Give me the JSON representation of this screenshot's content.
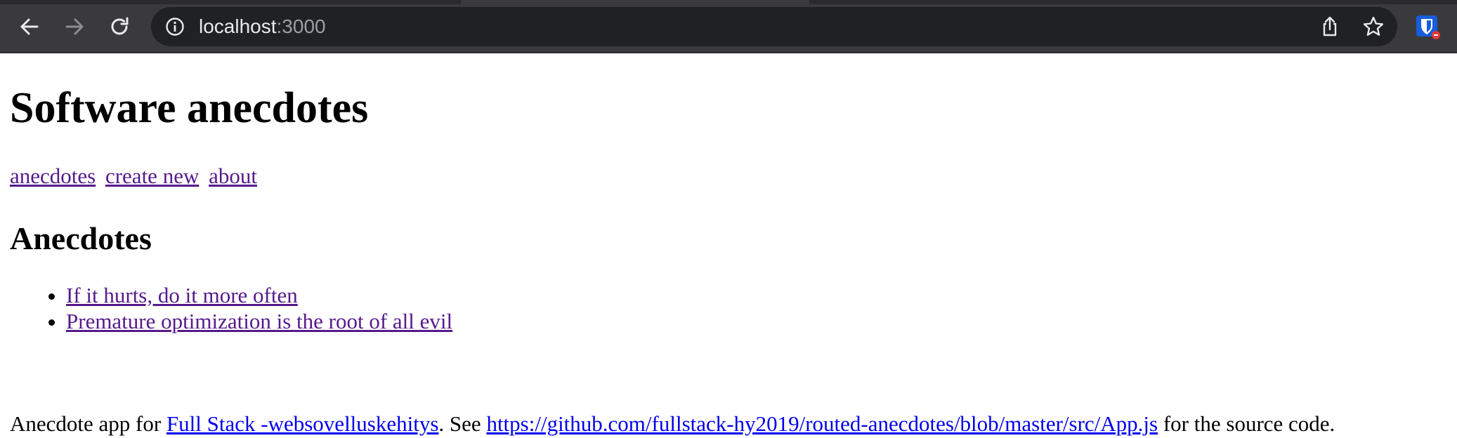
{
  "browser": {
    "url_host": "localhost",
    "url_port": ":3000",
    "icons": {
      "back": "arrow-left-icon",
      "forward": "arrow-right-icon",
      "reload": "reload-icon",
      "info": "info-icon",
      "share": "share-icon",
      "bookmark": "star-icon",
      "extension": "bitwarden-shield-icon"
    }
  },
  "page": {
    "title": "Software anecdotes",
    "nav": {
      "anecdotes": "anecdotes",
      "create_new": "create new",
      "about": "about"
    },
    "section_title": "Anecdotes",
    "anecdotes": [
      "If it hurts, do it more often",
      "Premature optimization is the root of all evil"
    ],
    "footer": {
      "prefix": "Anecdote app for ",
      "course_link": "Full Stack -websovelluskehitys",
      "middle": ". See ",
      "source_link": "https://github.com/fullstack-hy2019/routed-anecdotes/blob/master/src/App.js",
      "suffix": " for the source code."
    }
  },
  "colors": {
    "toolbar_bg": "#3a3a3c",
    "omnibox_bg": "#202124",
    "visited_link": "#551a8b",
    "link": "#0000ee"
  }
}
